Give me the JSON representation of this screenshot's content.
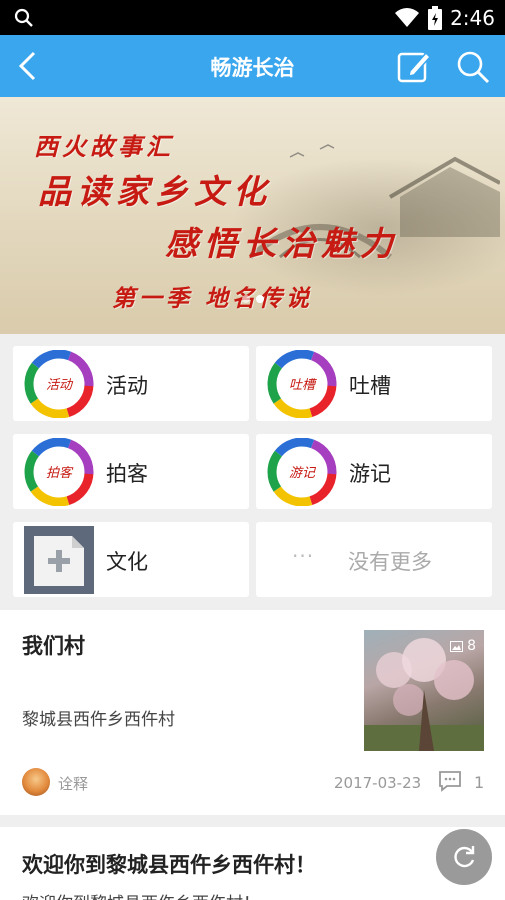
{
  "status_bar": {
    "time": "2:46",
    "icons": [
      "search-icon",
      "wifi-icon",
      "battery-icon"
    ]
  },
  "header": {
    "title": "畅游长治",
    "icons": [
      "back-arrow-icon",
      "edit-icon",
      "search-icon"
    ]
  },
  "banner": {
    "lines": [
      "西火故事汇",
      "品读家乡文化",
      "感悟长治魅力",
      "第一季 地名传说"
    ],
    "page_indicator": {
      "count": 2,
      "active": 1
    }
  },
  "grid": {
    "items": [
      {
        "label": "活动",
        "icon_text": "活动"
      },
      {
        "label": "吐槽",
        "icon_text": "吐槽"
      },
      {
        "label": "拍客",
        "icon_text": "拍客"
      },
      {
        "label": "游记",
        "icon_text": "游记"
      },
      {
        "label": "文化",
        "icon_text": ""
      },
      {
        "label": "没有更多",
        "prefix": "···"
      }
    ]
  },
  "feed": [
    {
      "title": "我们村",
      "subtitle": "黎城县西仵乡西仵村",
      "photo_count": "8",
      "author": "诠释",
      "date": "2017-03-23",
      "comments": "1"
    },
    {
      "title": "欢迎你到黎城县西仵乡西仵村！",
      "preview": "欢迎你到黎城县西仵乡西仵村！"
    }
  ],
  "colors": {
    "header_blue": "#3aa6ee",
    "banner_red": "#c61a12",
    "ring_colors": [
      "#e8232a",
      "#f3c300",
      "#1fa34a",
      "#2b6fd6",
      "#a63fbf"
    ]
  }
}
